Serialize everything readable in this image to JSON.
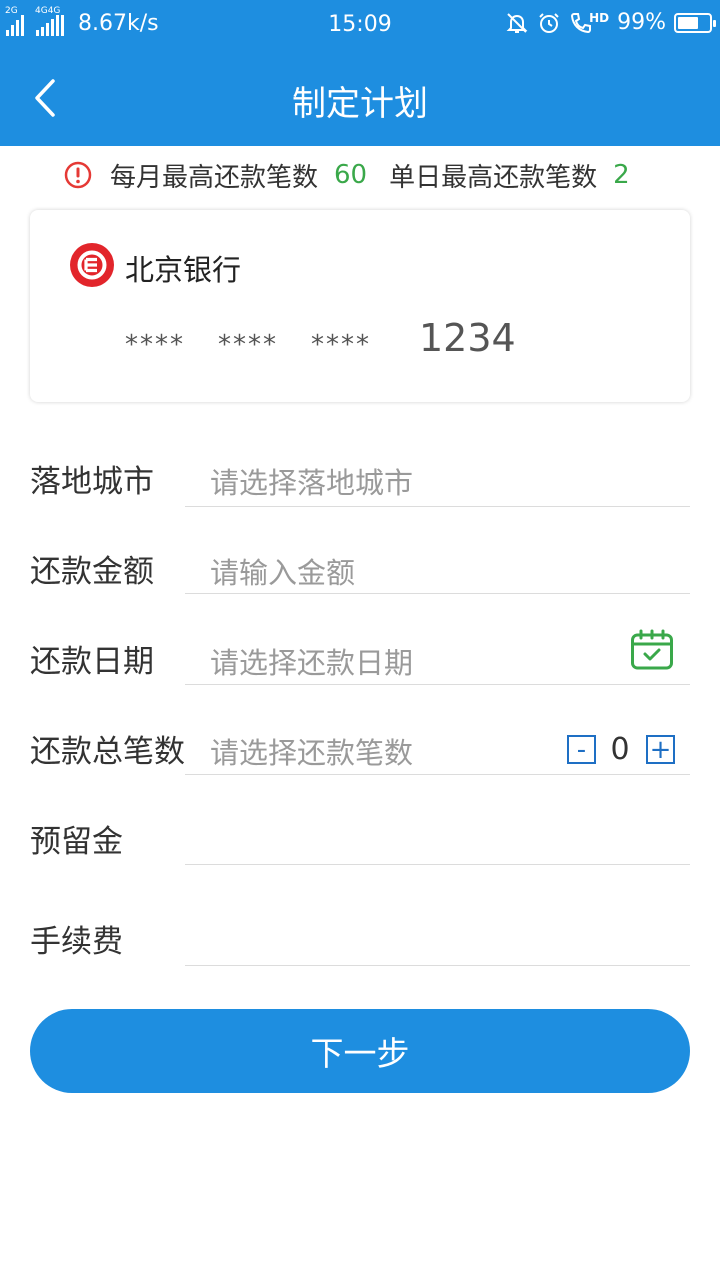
{
  "status_bar": {
    "sim1_label": "2G",
    "sim2_label": "4G4G",
    "network_speed": "8.67k/s",
    "time": "15:09",
    "hd_label": "HD",
    "battery": "99%",
    "battery_level": 0.99
  },
  "header": {
    "title": "制定计划",
    "back_icon": "chevron-left-icon"
  },
  "notice": {
    "icon": "warning-circle-icon",
    "monthly_label": "每月最高还款笔数",
    "monthly_value": "60",
    "daily_label": "单日最高还款笔数",
    "daily_value": "2"
  },
  "card": {
    "bank_name": "北京银行",
    "mask_1": "****",
    "mask_2": "****",
    "mask_3": "****",
    "last_digits": "1234"
  },
  "form": {
    "city": {
      "label": "落地城市",
      "placeholder": "请选择落地城市"
    },
    "amount": {
      "label": "还款金额",
      "placeholder": "请输入金额"
    },
    "date": {
      "label": "还款日期",
      "placeholder": "请选择还款日期",
      "icon": "calendar-check-icon"
    },
    "count": {
      "label": "还款总笔数",
      "placeholder": "请选择还款笔数",
      "minus": "-",
      "value": "0",
      "plus": "+"
    },
    "reserve": {
      "label": "预留金"
    },
    "fee": {
      "label": "手续费"
    }
  },
  "next_button": "下一步",
  "colors": {
    "primary": "#1e8ee0",
    "accent_green": "#3aa84a",
    "warning_red": "#e53935",
    "stepper_blue": "#1e6fc4"
  }
}
